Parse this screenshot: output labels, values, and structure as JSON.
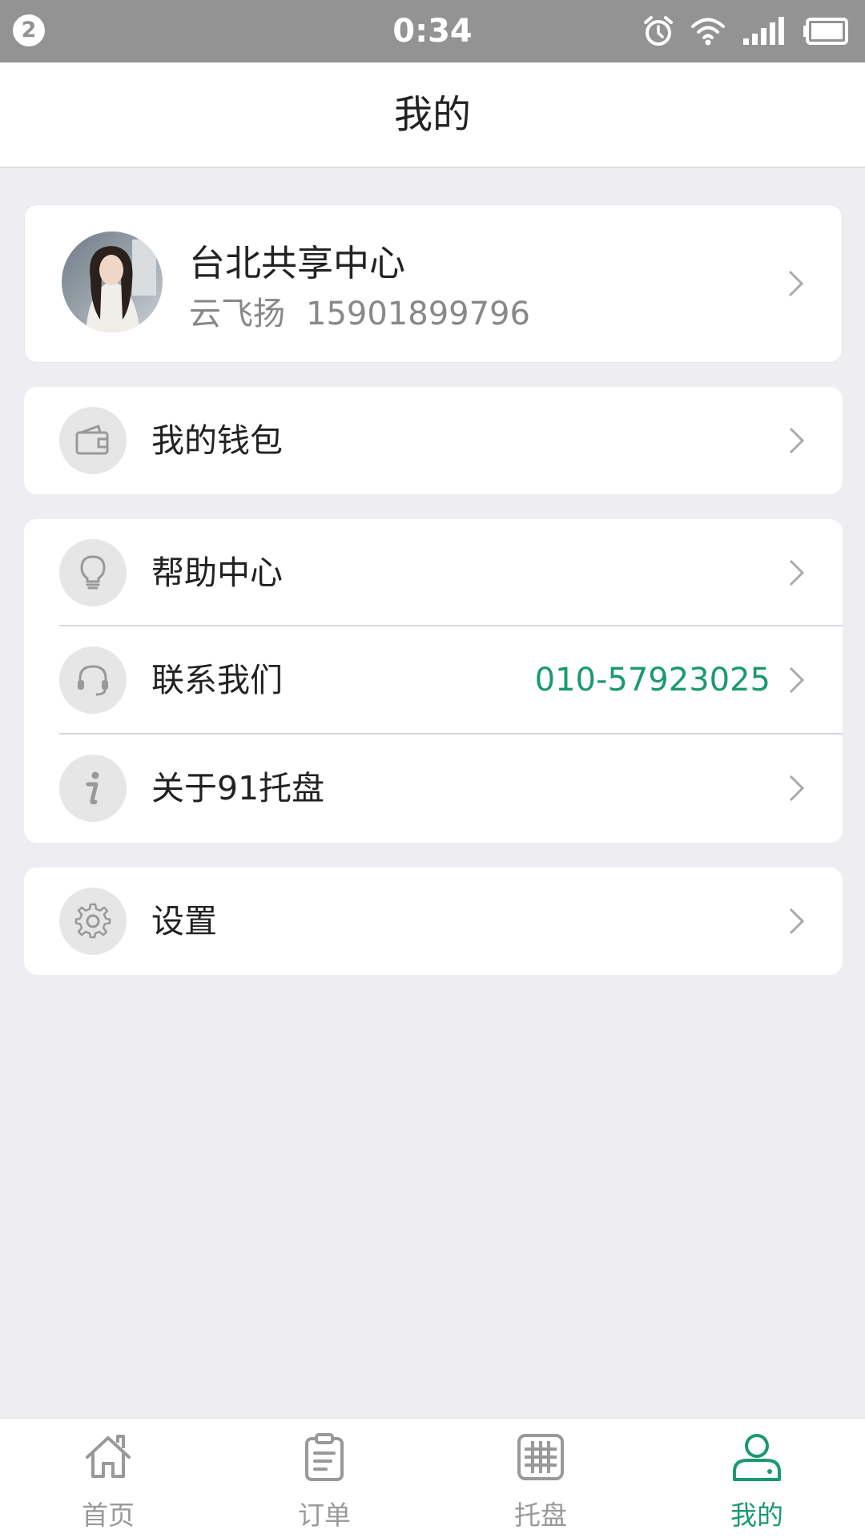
{
  "status_bar": {
    "notification_count": "2",
    "time": "0:34"
  },
  "header": {
    "title": "我的"
  },
  "profile": {
    "org_name": "台北共享中心",
    "user_name": "云飞扬",
    "phone": "15901899796"
  },
  "menu": {
    "wallet": {
      "label": "我的钱包"
    },
    "help": {
      "label": "帮助中心"
    },
    "contact": {
      "label": "联系我们",
      "value": "010-57923025"
    },
    "about": {
      "label": "关于91托盘"
    },
    "settings": {
      "label": "设置"
    }
  },
  "tabs": [
    {
      "label": "首页",
      "icon": "home-icon"
    },
    {
      "label": "订单",
      "icon": "order-clipboard-icon"
    },
    {
      "label": "托盘",
      "icon": "pallet-grid-icon"
    },
    {
      "label": "我的",
      "icon": "user-icon",
      "active": true
    }
  ],
  "colors": {
    "accent": "#1a9a6c",
    "status_bar": "#939393",
    "background": "#eeeef2"
  }
}
